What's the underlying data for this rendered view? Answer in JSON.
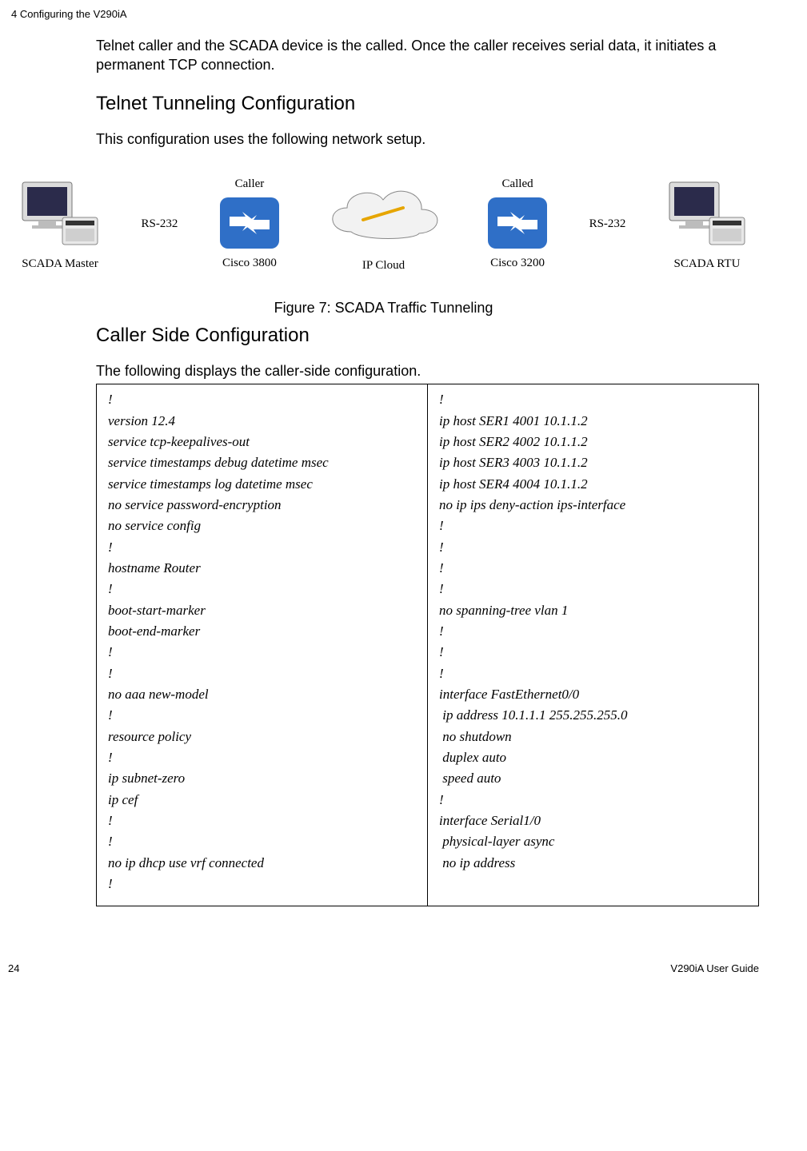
{
  "header": "4 Configuring the V290iA",
  "intro_para": "Telnet caller and the SCADA device is the called. Once the caller receives serial data, it initiates a permanent TCP connection.",
  "section_telnet_heading": "Telnet Tunneling Configuration",
  "section_telnet_para": "This configuration uses the following network setup.",
  "diagram": {
    "scada_master": "SCADA Master",
    "rs232_left": "RS-232",
    "caller": "Caller",
    "cisco3800": "Cisco 3800",
    "ip_cloud": "IP Cloud",
    "called": "Called",
    "cisco3200": "Cisco 3200",
    "rs232_right": "RS-232",
    "scada_rtu": "SCADA RTU"
  },
  "figure_caption": "Figure 7: SCADA Traffic Tunneling",
  "section_caller_heading": "Caller Side Configuration",
  "section_caller_para": "The following displays the caller-side configuration.",
  "config_left": [
    "!",
    "version 12.4",
    "service tcp-keepalives-out",
    "service timestamps debug datetime msec",
    "service timestamps log datetime msec",
    "no service password-encryption",
    "no service config",
    "!",
    "hostname Router",
    "!",
    "boot-start-marker",
    "boot-end-marker",
    "!",
    "!",
    "no aaa new-model",
    "!",
    "resource policy",
    "!",
    "ip subnet-zero",
    "ip cef",
    "!",
    "!",
    "no ip dhcp use vrf connected",
    "!"
  ],
  "config_right": [
    "!",
    "ip host SER1 4001 10.1.1.2",
    "ip host SER2 4002 10.1.1.2",
    "ip host SER3 4003 10.1.1.2",
    "ip host SER4 4004 10.1.1.2",
    "no ip ips deny-action ips-interface",
    "!",
    "!",
    "!",
    "!",
    "no spanning-tree vlan 1",
    "!",
    "!",
    "!",
    "interface FastEthernet0/0",
    " ip address 10.1.1.1 255.255.255.0",
    " no shutdown",
    " duplex auto",
    " speed auto",
    "!",
    "interface Serial1/0",
    " physical-layer async",
    " no ip address"
  ],
  "footer_left": "24",
  "footer_right": "V290iA User Guide"
}
